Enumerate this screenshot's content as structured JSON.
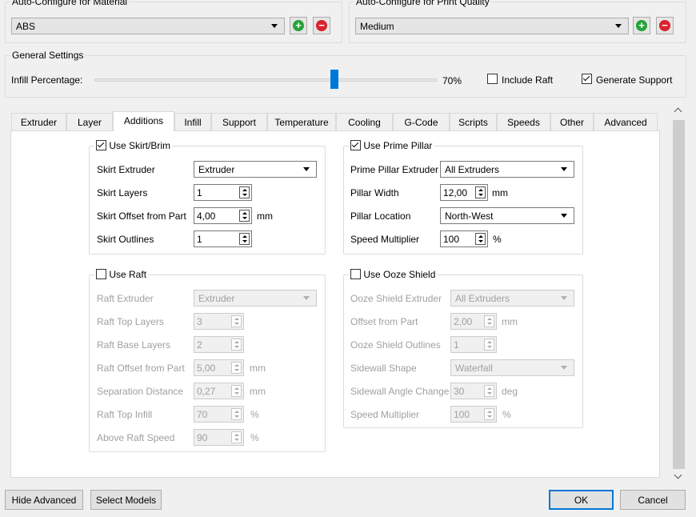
{
  "material": {
    "legend": "Auto-Configure for Material",
    "value": "ABS"
  },
  "quality": {
    "legend": "Auto-Configure for Print Quality",
    "value": "Medium"
  },
  "general": {
    "legend": "General Settings",
    "infill_label": "Infill Percentage:",
    "infill_value": "70%",
    "infill_fraction": 0.7,
    "include_raft": "Include Raft",
    "generate_support": "Generate Support"
  },
  "tabs": [
    "Extruder",
    "Layer",
    "Additions",
    "Infill",
    "Support",
    "Temperature",
    "Cooling",
    "G-Code",
    "Scripts",
    "Speeds",
    "Other",
    "Advanced"
  ],
  "active_tab": "Additions",
  "skirt": {
    "legend": "Use Skirt/Brim",
    "extruder_label": "Skirt Extruder",
    "extruder_value": "Extruder",
    "layers_label": "Skirt Layers",
    "layers_value": "1",
    "offset_label": "Skirt Offset from Part",
    "offset_value": "4,00",
    "offset_unit": "mm",
    "outlines_label": "Skirt Outlines",
    "outlines_value": "1"
  },
  "pillar": {
    "legend": "Use Prime Pillar",
    "extruder_label": "Prime Pillar Extruder",
    "extruder_value": "All Extruders",
    "width_label": "Pillar Width",
    "width_value": "12,00",
    "width_unit": "mm",
    "location_label": "Pillar Location",
    "location_value": "North-West",
    "speed_label": "Speed Multiplier",
    "speed_value": "100",
    "speed_unit": "%"
  },
  "raft": {
    "legend": "Use Raft",
    "extruder_label": "Raft Extruder",
    "extruder_value": "Extruder",
    "top_layers_label": "Raft Top Layers",
    "top_layers_value": "3",
    "base_layers_label": "Raft Base Layers",
    "base_layers_value": "2",
    "offset_label": "Raft Offset from Part",
    "offset_value": "5,00",
    "offset_unit": "mm",
    "separation_label": "Separation Distance",
    "separation_value": "0,27",
    "separation_unit": "mm",
    "top_infill_label": "Raft Top Infill",
    "top_infill_value": "70",
    "top_infill_unit": "%",
    "above_speed_label": "Above Raft Speed",
    "above_speed_value": "90",
    "above_speed_unit": "%"
  },
  "ooze": {
    "legend": "Use Ooze Shield",
    "extruder_label": "Ooze Shield Extruder",
    "extruder_value": "All Extruders",
    "offset_label": "Offset from Part",
    "offset_value": "2,00",
    "offset_unit": "mm",
    "outlines_label": "Ooze Shield Outlines",
    "outlines_value": "1",
    "sidewall_label": "Sidewall Shape",
    "sidewall_value": "Waterfall",
    "angle_label": "Sidewall Angle Change",
    "angle_value": "30",
    "angle_unit": "deg",
    "speed_label": "Speed Multiplier",
    "speed_value": "100",
    "speed_unit": "%"
  },
  "buttons": {
    "hide_advanced": "Hide Advanced",
    "select_models": "Select Models",
    "ok": "OK",
    "cancel": "Cancel"
  },
  "icons": {
    "add": "plus-circle-icon",
    "remove": "minus-circle-icon"
  },
  "colors": {
    "accent": "#0078d7",
    "slider": "#0078d7",
    "add": "#25a339",
    "remove": "#d9232d"
  }
}
